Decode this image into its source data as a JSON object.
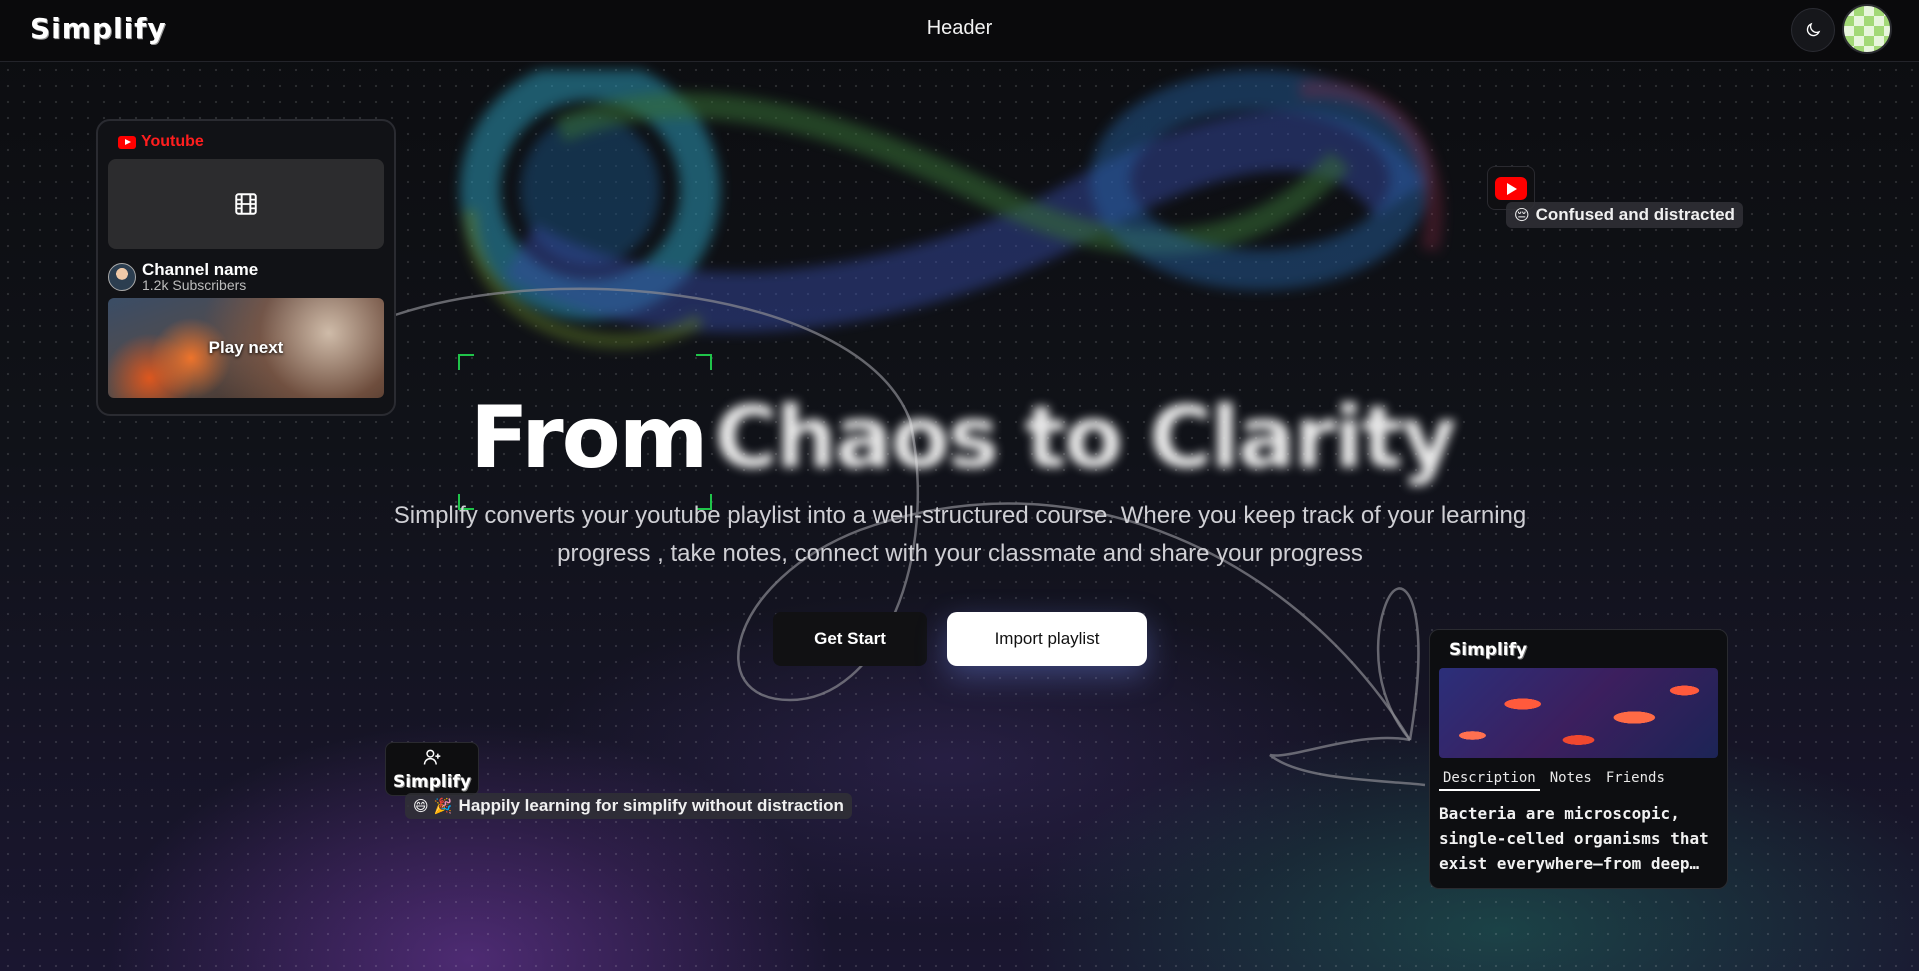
{
  "header": {
    "logo": "Simplify",
    "title": "Header",
    "theme_icon": "moon-icon",
    "avatar": "avatar"
  },
  "youtube_card": {
    "brand": "Youtube",
    "video_icon": "film-icon",
    "channel_name": "Channel name",
    "subscribers": "1.2k Subscribers",
    "play_next": "Play next"
  },
  "confused_badge": {
    "emoji": "😔",
    "text": "Confused and distracted"
  },
  "hero": {
    "title_word": "From",
    "title_rest": "Chaos to Clarity",
    "subtitle_line1": "Simplify converts your youtube playlist into a well-structured course. Where you keep track of your learning",
    "subtitle_line2": "progress , take notes, connect with your classmate and share your progress"
  },
  "buttons": {
    "get_start": "Get Start",
    "import_playlist": "Import playlist"
  },
  "simplify_badge": {
    "label": "Simplify",
    "icon": "add-user-icon"
  },
  "happy_badge": {
    "emoji": "😄 🎉",
    "text": "Happily learning for simplify without distraction"
  },
  "simplify_card": {
    "title": "Simplify",
    "tabs": [
      "Description",
      "Notes",
      "Friends"
    ],
    "description": "Bacteria are microscopic, single-celled organisms that exist everywhere—from deep…"
  },
  "colors": {
    "accent_green": "#20c44a",
    "youtube_red": "#ff0000",
    "background": "#0b0c10"
  }
}
